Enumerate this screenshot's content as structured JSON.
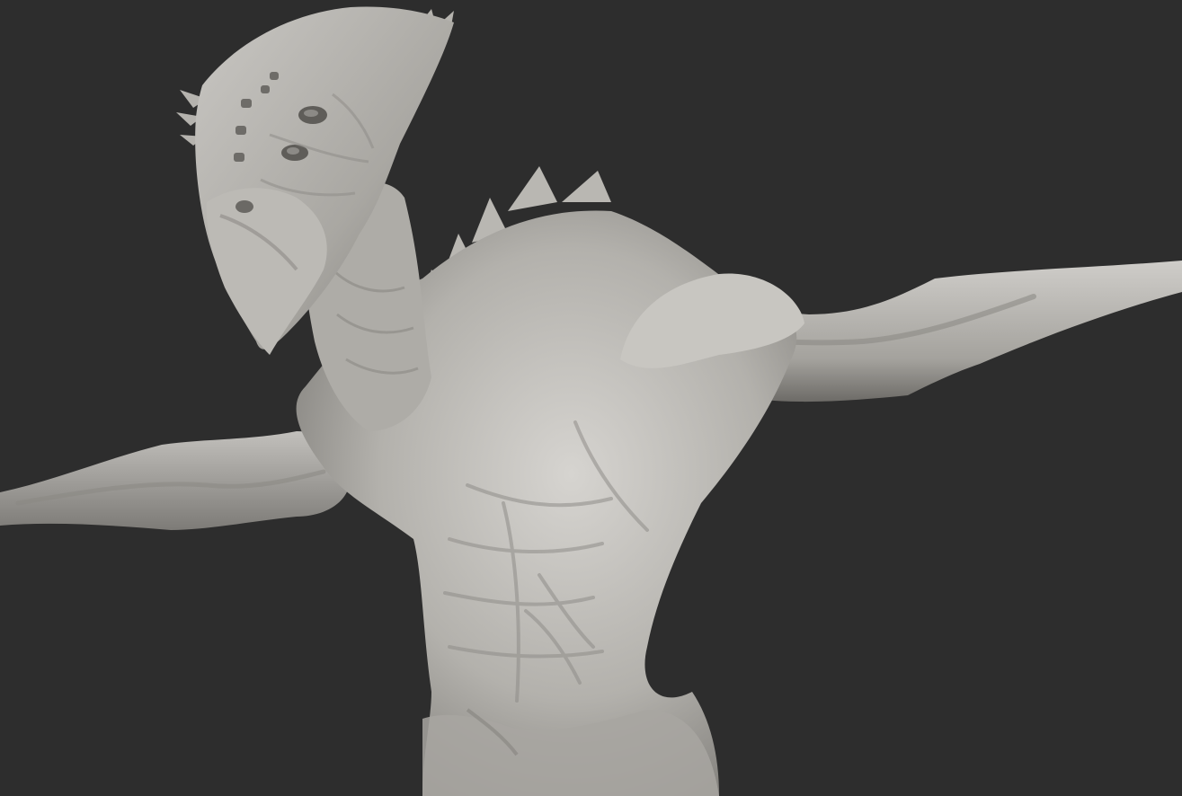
{
  "viewport": {
    "background_color": "#2d2d2d",
    "model_color": "#bdbbb6",
    "model_shadow_color": "#6f6d69",
    "model_highlight_color": "#dcdad6",
    "model_description_name": "creature-sculpt"
  }
}
